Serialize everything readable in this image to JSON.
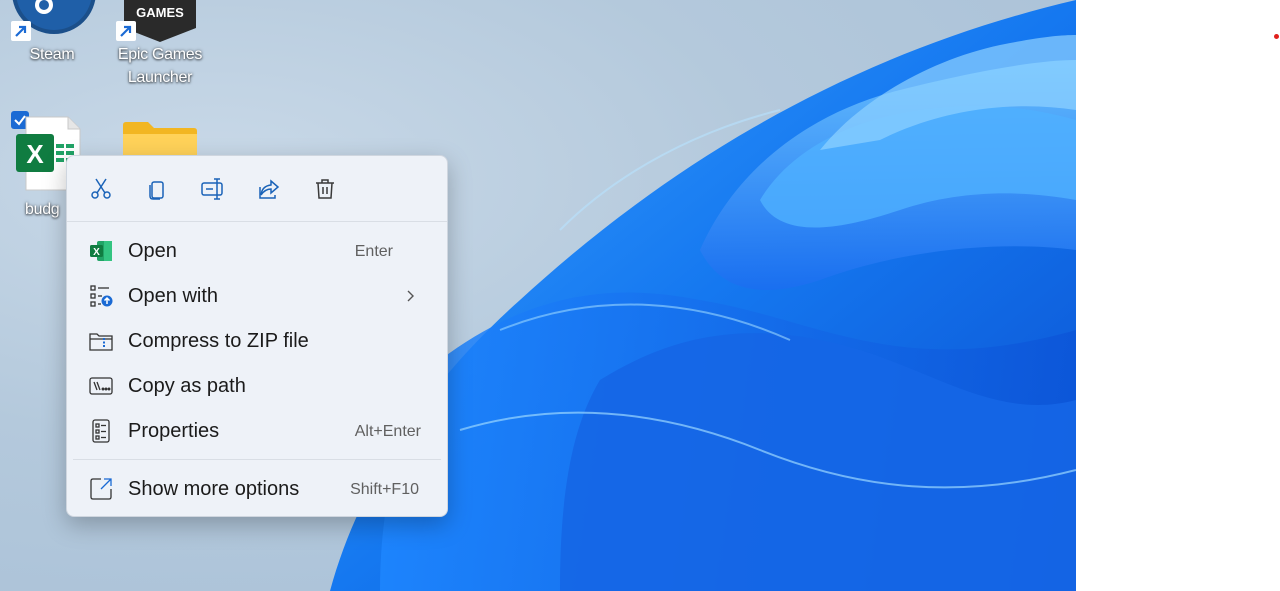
{
  "desktop": {
    "icons": [
      {
        "label": "Steam"
      },
      {
        "label_line1": "Epic Games",
        "label_line2": "Launcher",
        "badge": "GAMES"
      },
      {
        "label": "budg"
      },
      {
        "label": ""
      }
    ]
  },
  "context_menu": {
    "toolbar": [
      {
        "name": "cut-icon"
      },
      {
        "name": "copy-icon"
      },
      {
        "name": "rename-icon"
      },
      {
        "name": "share-icon"
      },
      {
        "name": "delete-icon"
      }
    ],
    "items": [
      {
        "label": "Open",
        "shortcut": "Enter",
        "icon": "excel-icon"
      },
      {
        "label": "Open with",
        "shortcut": "",
        "icon": "open-with-icon"
      },
      {
        "label": "Compress to ZIP file",
        "shortcut": "",
        "icon": "zip-icon"
      },
      {
        "label": "Copy as path",
        "shortcut": "",
        "icon": "copy-path-icon"
      },
      {
        "label": "Properties",
        "shortcut": "Alt+Enter",
        "icon": "properties-icon"
      },
      {
        "label": "Show more options",
        "shortcut": "Shift+F10",
        "icon": "more-options-icon"
      }
    ]
  },
  "colors": {
    "accent": "#0067c0",
    "wallpaper_blue": "#1a73e8",
    "excel_green": "#107c41"
  }
}
